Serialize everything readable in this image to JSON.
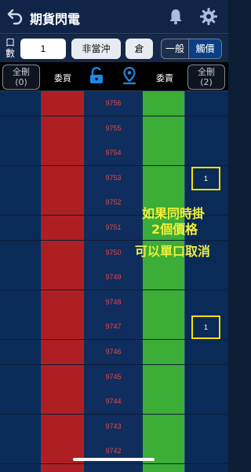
{
  "header": {
    "title": "期貨閃電",
    "back_icon": "back-arrow-icon",
    "bell_icon": "bell-icon",
    "settings_icon": "gear-icon"
  },
  "controls": {
    "qty_label": "口數",
    "qty_value": "1",
    "non_day_trade": "非當沖",
    "position": "倉",
    "mode_general": "一般",
    "mode_trigger": "觸價"
  },
  "columns": {
    "delete_all_left": "全刪",
    "delete_all_left_count": "(0)",
    "buy": "委買",
    "sell": "委賣",
    "delete_all_right": "全刪",
    "delete_all_right_count": "(2)",
    "lock_icon": "unlock-icon",
    "pin_icon": "location-pin-icon"
  },
  "ladder": {
    "prices": [
      "9756",
      "9755",
      "9754",
      "9753",
      "9752",
      "9751",
      "9750",
      "9749",
      "9748",
      "9747",
      "9746",
      "9745",
      "9744",
      "9743",
      "9742",
      "9741"
    ],
    "orders": [
      {
        "price": "9753",
        "qty": "1"
      },
      {
        "price": "9747",
        "qty": "1"
      }
    ]
  },
  "annotation": {
    "line1": "如果同時掛",
    "line2": "2個價格",
    "line3": "可以單口取消"
  },
  "colors": {
    "buy": "#ae1f23",
    "sell": "#3cad37",
    "highlight": "#f5e100",
    "price_text": "#e0484a"
  }
}
